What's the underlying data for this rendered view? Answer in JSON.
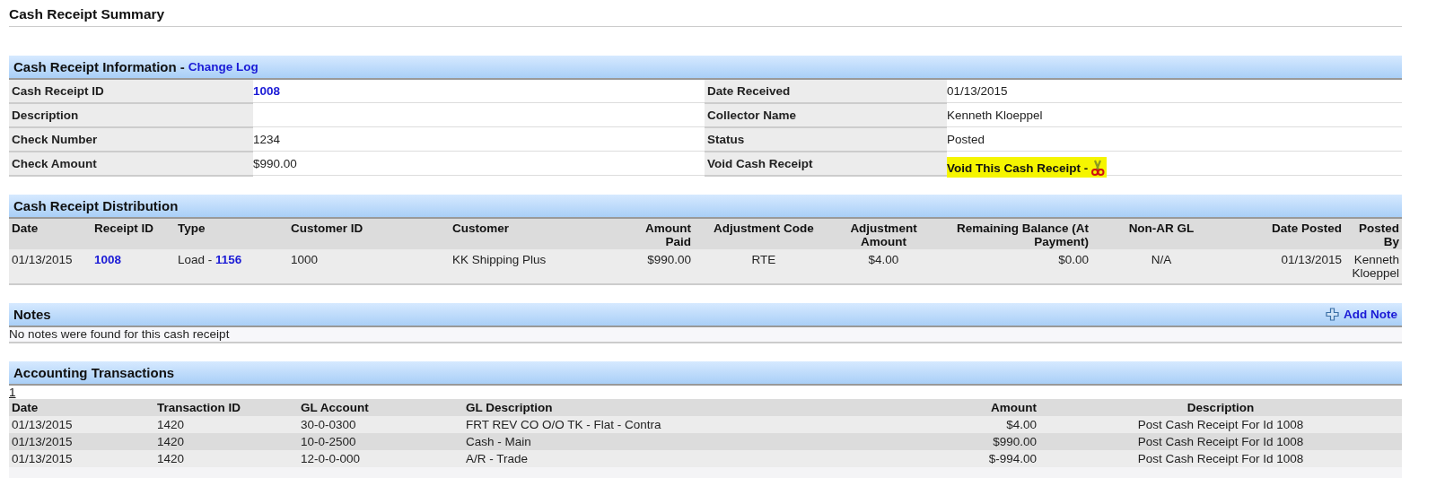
{
  "page_title": "Cash Receipt Summary",
  "information": {
    "title": "Cash Receipt Information",
    "title_separator": "-",
    "link": "Change Log",
    "rows": [
      {
        "left": {
          "label": "Cash Receipt ID",
          "value": "1008",
          "kind": "link"
        },
        "right": {
          "label": "Date Received",
          "value": "01/13/2015",
          "kind": "text"
        }
      },
      {
        "left": {
          "label": "Description",
          "kind": "empty"
        },
        "right": {
          "label": "Collector Name",
          "value": "Kenneth Kloeppel",
          "kind": "text"
        }
      },
      {
        "left": {
          "label": "Check Number",
          "value": "1234",
          "kind": "text"
        },
        "right": {
          "label": "Status",
          "value": "Posted",
          "kind": "text"
        }
      },
      {
        "left": {
          "label": "Check Amount",
          "value": "$990.00",
          "kind": "text"
        },
        "right": {
          "label": "Void Cash Receipt",
          "value": "Void This Cash Receipt -",
          "kind": "void"
        }
      }
    ]
  },
  "distribution": {
    "title": "Cash Receipt Distribution",
    "columns": [
      {
        "label": "Date"
      },
      {
        "label": "Receipt ID"
      },
      {
        "label": "Type"
      },
      {
        "label": "Customer ID"
      },
      {
        "label": "Customer"
      },
      {
        "label": "Amount Paid"
      },
      {
        "label": "Adjustment Code"
      },
      {
        "label": "Adjustment Amount"
      },
      {
        "label": "Remaining Balance (At Payment)"
      },
      {
        "label": "Non-AR GL"
      },
      {
        "label": "Date Posted"
      },
      {
        "label": "Posted By"
      }
    ],
    "rows": [
      {
        "cells": [
          {
            "kind": "text",
            "text": "01/13/2015"
          },
          {
            "kind": "link",
            "text": "1008"
          },
          {
            "kind": "mixed",
            "text": "Load -",
            "link": "1156"
          },
          {
            "kind": "text",
            "text": "1000"
          },
          {
            "kind": "text",
            "text": "KK Shipping Plus"
          },
          {
            "kind": "text",
            "text": "$990.00"
          },
          {
            "kind": "text",
            "text": "RTE"
          },
          {
            "kind": "text",
            "text": "$4.00"
          },
          {
            "kind": "text",
            "text": "$0.00"
          },
          {
            "kind": "text",
            "text": "N/A"
          },
          {
            "kind": "text",
            "text": "01/13/2015"
          },
          {
            "kind": "text",
            "text": "Kenneth Kloeppel"
          }
        ]
      }
    ]
  },
  "notes": {
    "title": "Notes",
    "action": "Add Note",
    "empty_message": "No notes were found for this cash receipt"
  },
  "transactions": {
    "title": "Accounting Transactions",
    "pages": [
      {
        "label": "1",
        "selected": true
      }
    ],
    "columns": [
      {
        "label": "Date"
      },
      {
        "label": "Transaction ID"
      },
      {
        "label": "GL Account"
      },
      {
        "label": "GL Description"
      },
      {
        "label": "Amount"
      },
      {
        "label": "Description"
      }
    ],
    "rows": [
      [
        "01/13/2015",
        "1420",
        "30-0-0300",
        "FRT REV CO O/O TK - Flat - Contra",
        "$4.00",
        "Post Cash Receipt For Id 1008"
      ],
      [
        "01/13/2015",
        "1420",
        "10-0-2500",
        "Cash - Main",
        "$990.00",
        "Post Cash Receipt For Id 1008"
      ],
      [
        "01/13/2015",
        "1420",
        "12-0-0-000",
        "A/R - Trade",
        "$-994.00",
        "Post Cash Receipt For Id 1008"
      ]
    ]
  }
}
